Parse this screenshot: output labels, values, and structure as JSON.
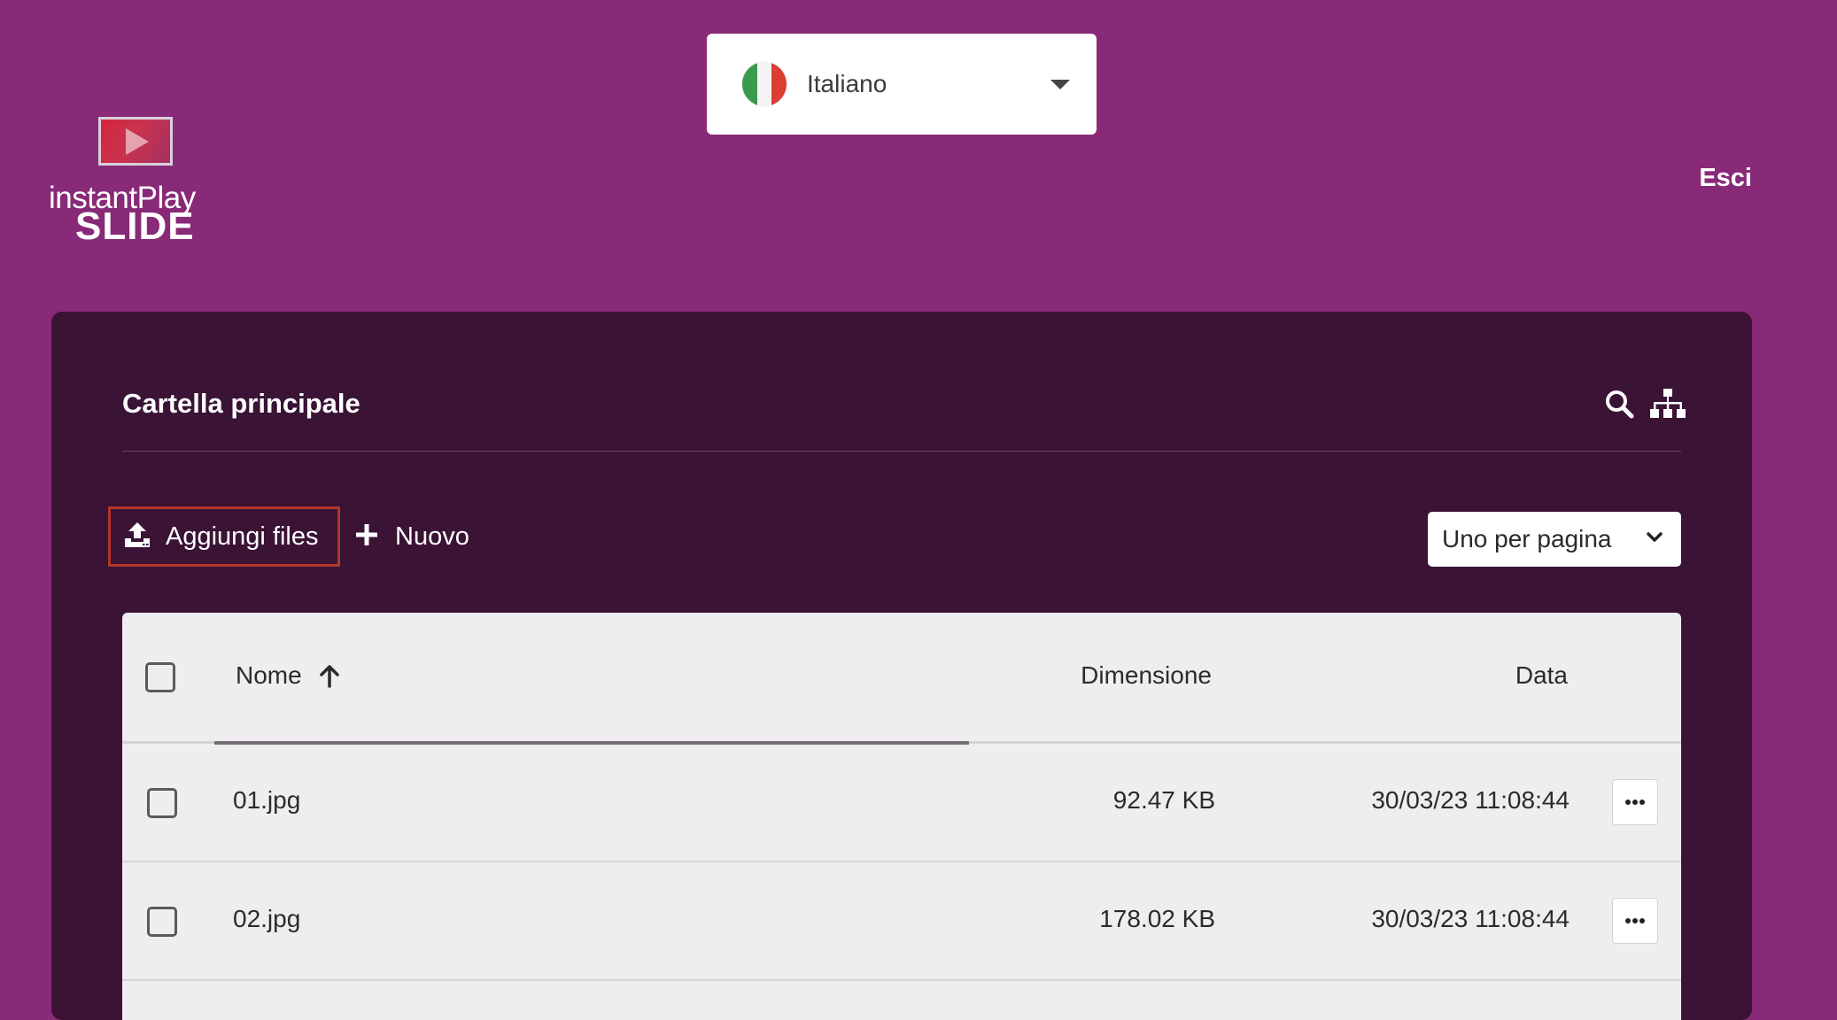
{
  "language": {
    "label": "Italiano",
    "flag": "italian-flag"
  },
  "logo": {
    "line1": "instantPlay",
    "line2": "SLIDE"
  },
  "header": {
    "exit_label": "Esci"
  },
  "panel": {
    "title": "Cartella principale",
    "icons": [
      "search-icon",
      "sitemap-icon"
    ]
  },
  "toolbar": {
    "upload_label": "Aggiungi files",
    "new_label": "Nuovo",
    "view_select_value": "Uno per pagina"
  },
  "table": {
    "columns": {
      "name": "Nome",
      "size": "Dimensione",
      "date": "Data"
    },
    "sort": {
      "column": "name",
      "direction": "ascending"
    },
    "rows": [
      {
        "name": "01.jpg",
        "size": "92.47 KB",
        "date": "30/03/23 11:08:44"
      },
      {
        "name": "02.jpg",
        "size": "178.02 KB",
        "date": "30/03/23 11:08:44"
      }
    ]
  },
  "colors": {
    "background": "#882a78",
    "panel": "#3a1335",
    "table": "#efedf0",
    "highlight_border": "#b2372a"
  }
}
